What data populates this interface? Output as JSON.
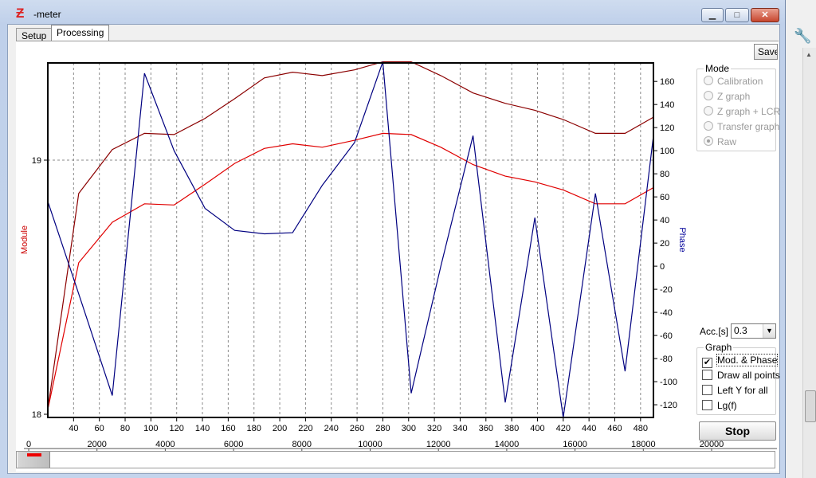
{
  "window": {
    "title": "-meter",
    "minimize_glyph": "▁",
    "maximize_glyph": "□",
    "close_glyph": "✕"
  },
  "tabs": [
    {
      "label": "Setup",
      "active": false
    },
    {
      "label": "Processing",
      "active": true
    }
  ],
  "toolbar": {
    "save_label": "Save"
  },
  "mode_group": {
    "title": "Mode",
    "options": [
      {
        "label": "Calibration",
        "selected": false
      },
      {
        "label": "Z graph",
        "selected": false
      },
      {
        "label": "Z graph + LCR",
        "selected": false
      },
      {
        "label": "Transfer graph",
        "selected": false
      },
      {
        "label": "Raw",
        "selected": true
      }
    ]
  },
  "acc": {
    "label": "Acc.[s]",
    "value": "0.3"
  },
  "graph_group": {
    "title": "Graph",
    "options": [
      {
        "label": "Mod. & Phase",
        "checked": true
      },
      {
        "label": "Draw all points",
        "checked": false
      },
      {
        "label": "Left Y for all",
        "checked": false
      },
      {
        "label": "Lg(f)",
        "checked": false
      }
    ]
  },
  "stop_label": "Stop",
  "colors": {
    "module_axis": "#cc0000",
    "phase_axis": "#000099",
    "series_dark_red": "#8b0000",
    "series_red": "#e00000",
    "series_blue": "#000080"
  },
  "chart_data": {
    "type": "line",
    "ylabel_left": "Module",
    "ylabel_right": "Phase",
    "x_ticks": [
      "40",
      "60",
      "80",
      "100",
      "120",
      "140",
      "160",
      "180",
      "200",
      "220",
      "240",
      "260",
      "280",
      "300",
      "320",
      "340",
      "360",
      "380",
      "400",
      "420",
      "440",
      "460",
      "480"
    ],
    "x_range": [
      20,
      490
    ],
    "left_ticks": [
      "19",
      "18"
    ],
    "right_ticks": [
      "160",
      "140",
      "120",
      "100",
      "80",
      "60",
      "40",
      "20",
      "0",
      "-20",
      "-40",
      "-60",
      "-80",
      "-100",
      "-120"
    ],
    "right_range": [
      -131,
      176
    ],
    "series": [
      {
        "color": "#8b0000",
        "axis": "phase",
        "x": [
          20,
          44,
          70,
          95,
          118,
          142,
          165,
          188,
          210,
          233,
          258,
          280,
          302,
          325,
          350,
          375,
          398,
          420,
          445,
          468,
          490
        ],
        "y": [
          -124,
          63,
          101,
          115,
          114,
          128,
          145,
          163,
          168,
          165,
          170,
          177,
          177,
          165,
          150,
          141,
          135,
          127,
          115,
          115,
          129
        ]
      },
      {
        "color": "#e00000",
        "axis": "phase",
        "x": [
          20,
          44,
          70,
          95,
          118,
          142,
          165,
          188,
          210,
          233,
          258,
          280,
          302,
          325,
          350,
          375,
          398,
          420,
          445,
          468,
          490
        ],
        "y": [
          -124,
          3,
          38,
          54,
          53,
          71,
          89,
          102,
          106,
          103,
          109,
          115,
          114,
          103,
          88,
          78,
          73,
          66,
          54,
          54,
          68
        ]
      },
      {
        "color": "#000080",
        "axis": "phase",
        "x": [
          20,
          44,
          70,
          95,
          118,
          142,
          165,
          188,
          210,
          233,
          258,
          280,
          302,
          325,
          350,
          375,
          398,
          420,
          445,
          468,
          490
        ],
        "y": [
          56,
          -24,
          -112,
          167,
          100,
          50,
          31,
          28,
          29,
          70,
          107,
          177,
          -110,
          0,
          113,
          -118,
          42,
          -131,
          63,
          -91,
          113
        ]
      }
    ]
  },
  "bottom_axis": {
    "ticks": [
      "0",
      "2000",
      "4000",
      "6000",
      "8000",
      "10000",
      "12000",
      "14000",
      "16000",
      "18000",
      "20000"
    ],
    "range": [
      0,
      20000
    ]
  }
}
